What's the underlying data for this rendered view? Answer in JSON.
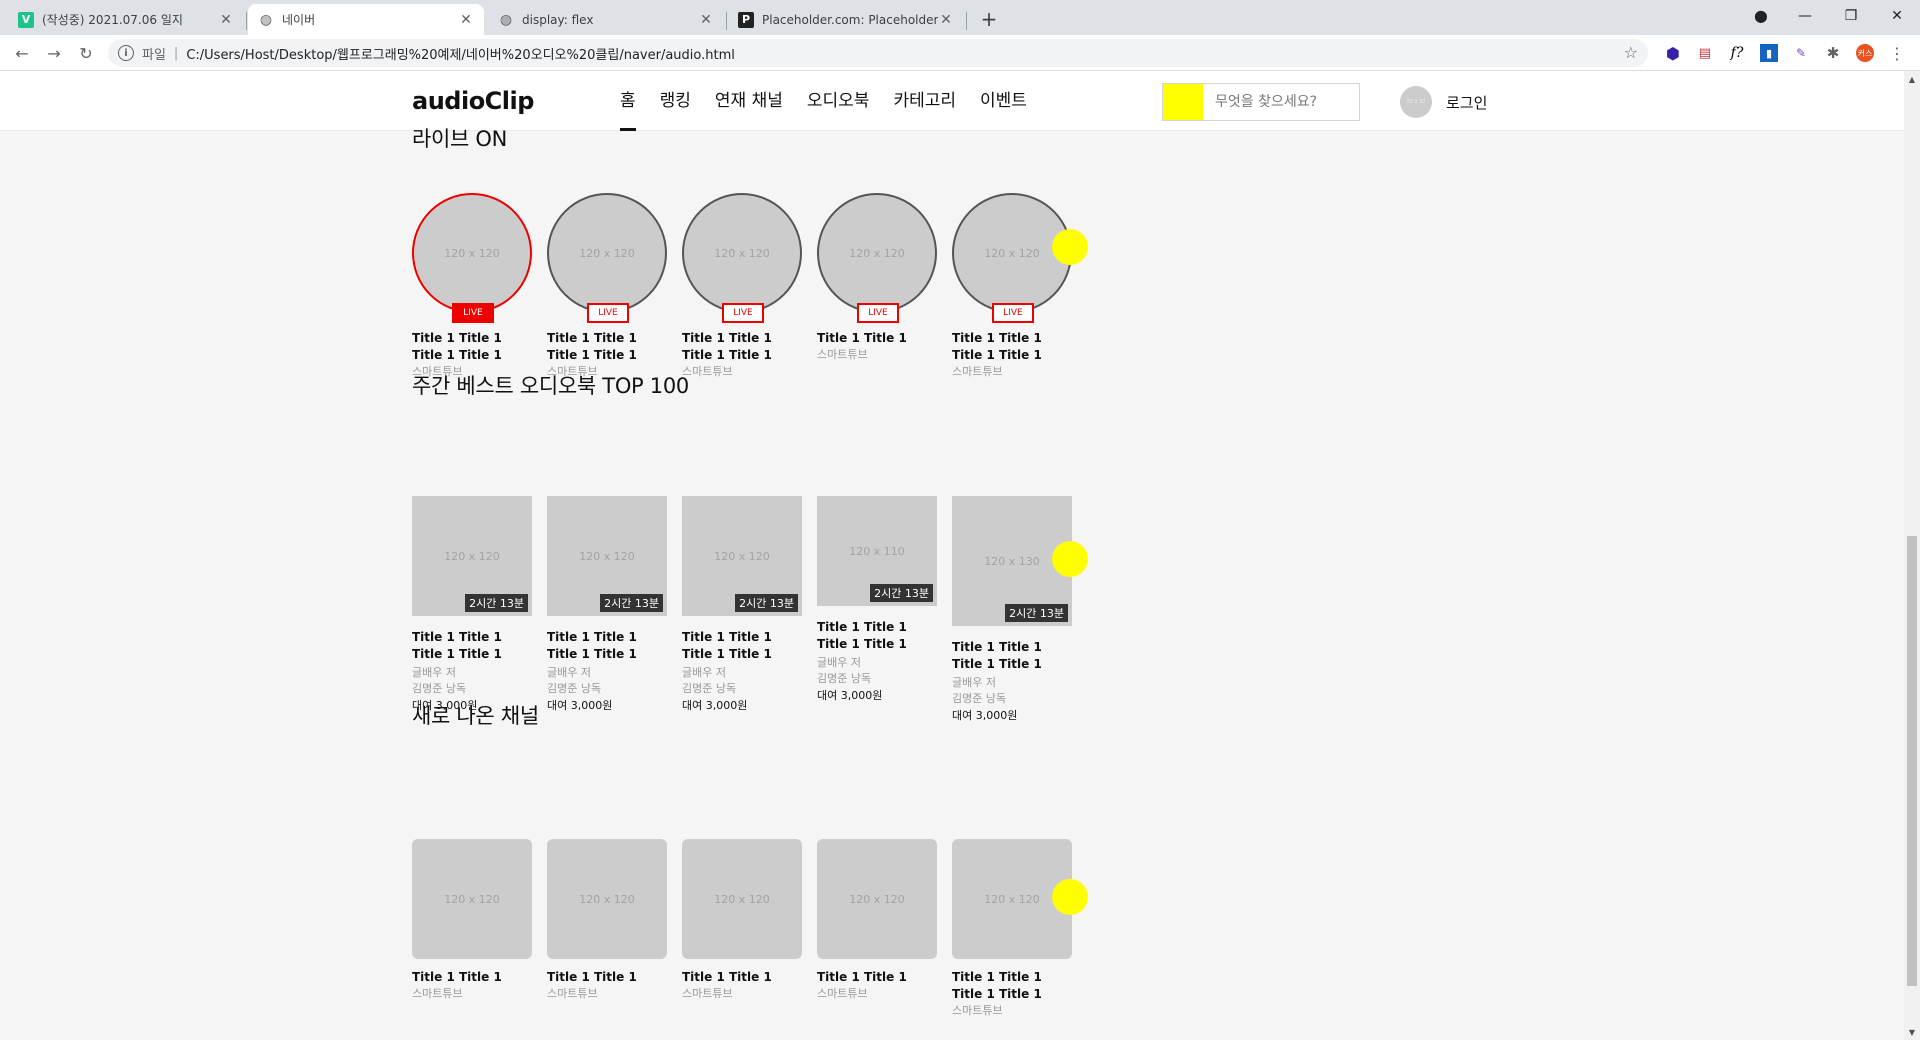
{
  "browser": {
    "tabs": [
      {
        "title": "(작성중) 2021.07.06 일지",
        "favicon": "V"
      },
      {
        "title": "네이버",
        "favicon": "globe"
      },
      {
        "title": "display: flex",
        "favicon": "globe"
      },
      {
        "title": "Placeholder.com: Placeholder.co",
        "favicon": "P"
      }
    ],
    "scheme": "파일",
    "url": "C:/Users/Host/Desktop/웹프로그래밍%20예제/네이버%20오디오%20클립/naver/audio.html",
    "ext_avatar": "커스"
  },
  "header": {
    "logo": "audioClip",
    "nav": [
      "홈",
      "랭킹",
      "연재 채널",
      "오디오북",
      "카테고리",
      "이벤트"
    ],
    "search_placeholder": "무엇을 찾으세요?",
    "avatar_text": "32 x 32",
    "login": "로그인"
  },
  "live": {
    "title": "라이브 ON",
    "badge": "LIVE",
    "items": [
      {
        "thumb": "120 x 120",
        "title": "Title 1 Title 1 Title 1 Title 1",
        "sub": "스마트튜브",
        "on": true
      },
      {
        "thumb": "120 x 120",
        "title": "Title 1 Title 1 Title 1 Title 1",
        "sub": "스마트튜브",
        "on": false
      },
      {
        "thumb": "120 x 120",
        "title": "Title 1 Title 1 Title 1 Title 1",
        "sub": "스마트튜브",
        "on": false
      },
      {
        "thumb": "120 x 120",
        "title": "Title 1 Title 1",
        "sub": "스마트튜브",
        "on": false
      },
      {
        "thumb": "120 x 120",
        "title": "Title 1 Title 1 Title 1 Title 1",
        "sub": "스마트튜브",
        "on": false
      }
    ]
  },
  "best": {
    "title": "주간 베스트 오디오북 TOP 100",
    "items": [
      {
        "thumb": "120 x 120",
        "duration": "2시간 13분",
        "title": "Title 1 Title 1 Title 1 Title 1",
        "author": "글배우 저",
        "reader": "김명준 낭독",
        "price": "대여 3,000원"
      },
      {
        "thumb": "120 x 120",
        "duration": "2시간 13분",
        "title": "Title 1 Title 1 Title 1 Title 1",
        "author": "글배우 저",
        "reader": "김명준 낭독",
        "price": "대여 3,000원"
      },
      {
        "thumb": "120 x 120",
        "duration": "2시간 13분",
        "title": "Title 1 Title 1 Title 1 Title 1",
        "author": "글배우 저",
        "reader": "김명준 낭독",
        "price": "대여 3,000원"
      },
      {
        "thumb": "120 x 110",
        "duration": "2시간 13분",
        "title": "Title 1 Title 1 Title 1 Title 1",
        "author": "글배우 저",
        "reader": "김명준 낭독",
        "price": "대여 3,000원"
      },
      {
        "thumb": "120 x 130",
        "duration": "2시간 13분",
        "title": "Title 1 Title 1 Title 1 Title 1",
        "author": "글배우 저",
        "reader": "김명준 낭독",
        "price": "대여 3,000원"
      }
    ]
  },
  "channels": {
    "title": "새로 나온 채널",
    "items": [
      {
        "thumb": "120 x 120",
        "title": "Title 1 Title 1",
        "sub": "스마트튜브"
      },
      {
        "thumb": "120 x 120",
        "title": "Title 1 Title 1",
        "sub": "스마트튜브"
      },
      {
        "thumb": "120 x 120",
        "title": "Title 1 Title 1",
        "sub": "스마트튜브"
      },
      {
        "thumb": "120 x 120",
        "title": "Title 1 Title 1",
        "sub": "스마트튜브"
      },
      {
        "thumb": "120 x 120",
        "title": "Title 1 Title 1 Title 1 Title 1",
        "sub": "스마트튜브"
      }
    ]
  },
  "colors": {
    "accent_yellow": "#ffff00",
    "live_red": "#ee0000",
    "placeholder": "#cccccc"
  }
}
